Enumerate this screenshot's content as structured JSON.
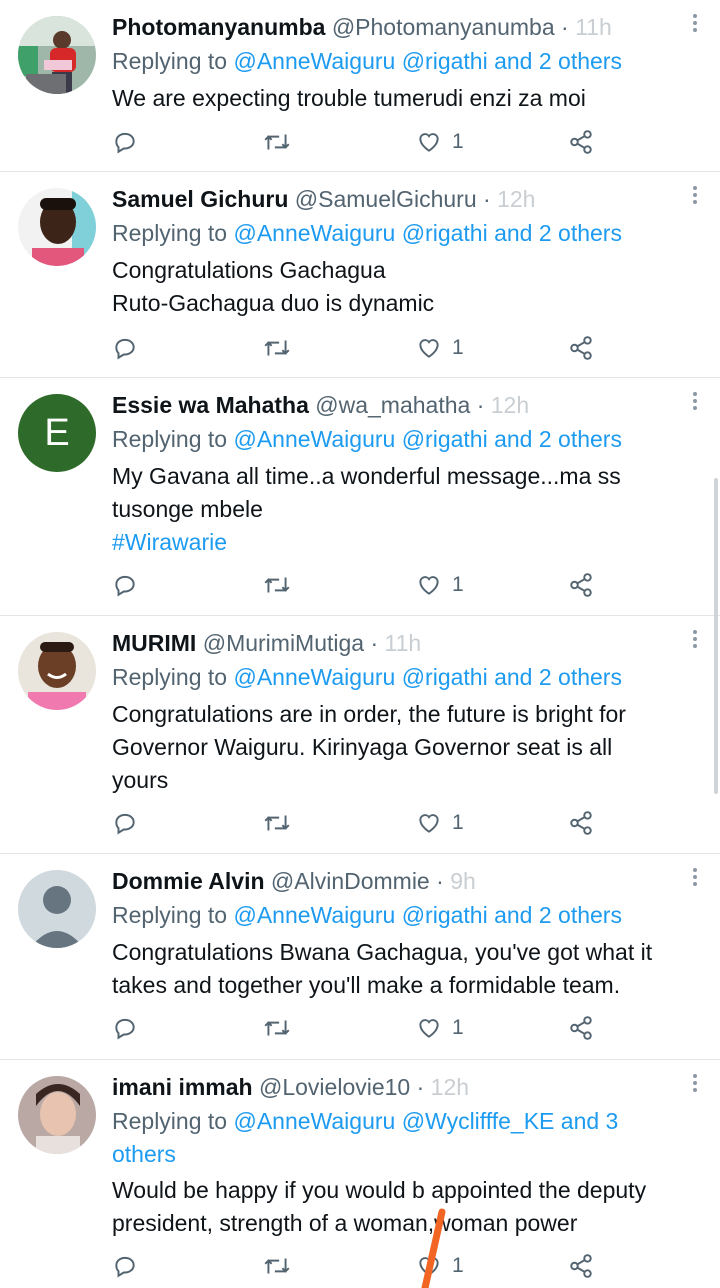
{
  "reply_prefix": "Replying to",
  "tweets": [
    {
      "name": "Photomanyanumba",
      "handle": "@Photomanyanumba",
      "sep": "·",
      "time": "11h",
      "mentions": "@AnneWaiguru @rigathi and 2 others",
      "lines": [
        "We are expecting trouble tumerudi enzi za moi"
      ],
      "likes": "1",
      "avatar": "photo-man-red"
    },
    {
      "name": "Samuel Gichuru",
      "handle": "@SamuelGichuru",
      "sep": "·",
      "time": "12h",
      "mentions": "@AnneWaiguru @rigathi and 2 others",
      "lines": [
        "Congratulations Gachagua",
        "Ruto-Gachagua duo is dynamic"
      ],
      "likes": "1",
      "avatar": "photo-man-pink"
    },
    {
      "name": "Essie wa Mahatha",
      "handle": "@wa_mahatha",
      "sep": "·",
      "time": "12h",
      "mentions": "@AnneWaiguru @rigathi and 2 others",
      "lines": [
        "My Gavana all time..a wonderful message...ma ss",
        "tusonge mbele"
      ],
      "hashtag": "#Wirawarie",
      "likes": "1",
      "avatar_letter": "E",
      "avatar_color": "#2e6b2a"
    },
    {
      "name": "MURIMI",
      "handle": "@MurimiMutiga",
      "sep": "·",
      "time": "11h",
      "mentions": "@AnneWaiguru @rigathi and 2 others",
      "lines": [
        "Congratulations are in order, the future is bright for",
        "Governor Waiguru. Kirinyaga Governor seat is all",
        "yours"
      ],
      "likes": "1",
      "avatar": "photo-man-smiling"
    },
    {
      "name": "Dommie Alvin",
      "handle": "@AlvinDommie",
      "sep": "·",
      "time": "9h",
      "mentions": "@AnneWaiguru @rigathi and 2 others",
      "lines": [
        "Congratulations Bwana Gachagua, you've got what it",
        "takes and together you'll make a formidable team."
      ],
      "likes": "1",
      "avatar": "default-profile"
    },
    {
      "name": "imani immah",
      "handle": "@Lovielovie10",
      "sep": "·",
      "time": "12h",
      "mentions_line1": "@AnneWaiguru @Wyclifffe_KE and 3",
      "mentions_line2": "others",
      "lines": [
        "Would be happy if you would b appointed the deputy",
        "president, strength of a woman,woman power"
      ],
      "likes": "1",
      "avatar": "photo-woman"
    }
  ],
  "colors": {
    "link": "#1d9bf0",
    "secondary": "#536471",
    "divider": "#e3e6e8",
    "annotation": "#f26522"
  }
}
